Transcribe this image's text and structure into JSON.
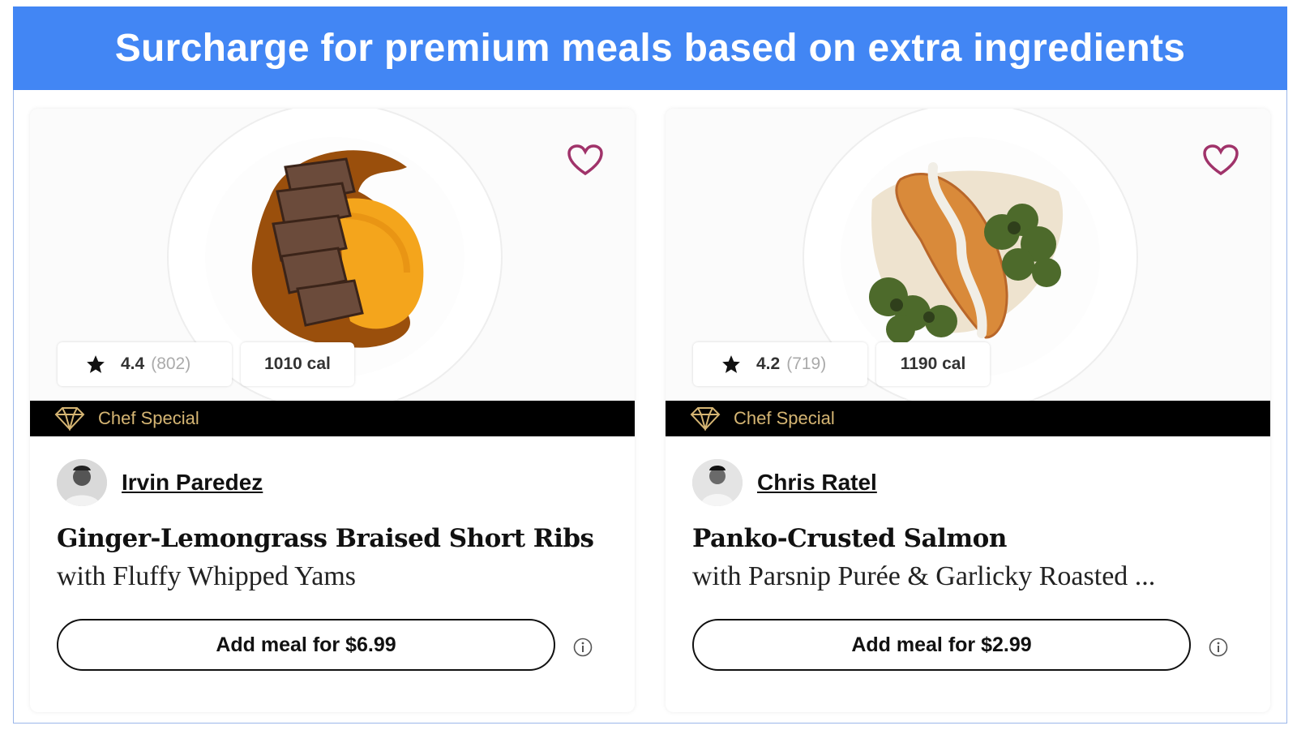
{
  "banner": {
    "title": "Surcharge for premium meals based on extra ingredients"
  },
  "colors": {
    "banner": "#4286f4",
    "chef_bar": "#000000",
    "chef_gold": "#d5b573",
    "heart": "#a0336a"
  },
  "cards": [
    {
      "rating": "4.4",
      "rating_count": "(802)",
      "calories": "1010 cal",
      "badge": "Chef Special",
      "chef": "Irvin Paredez",
      "title": "Ginger-Lemongrass Braised Short Ribs",
      "subtitle": "with Fluffy Whipped Yams",
      "button": "Add meal for $6.99",
      "icons": {
        "favorite": "heart-icon",
        "rating": "star-icon",
        "badge": "gem-icon",
        "info": "info-icon"
      }
    },
    {
      "rating": "4.2",
      "rating_count": "(719)",
      "calories": "1190 cal",
      "badge": "Chef Special",
      "chef": "Chris Ratel",
      "title": "Panko-Crusted Salmon",
      "subtitle": "with Parsnip Purée & Garlicky Roasted ...",
      "button": "Add meal for $2.99",
      "icons": {
        "favorite": "heart-icon",
        "rating": "star-icon",
        "badge": "gem-icon",
        "info": "info-icon"
      }
    }
  ]
}
